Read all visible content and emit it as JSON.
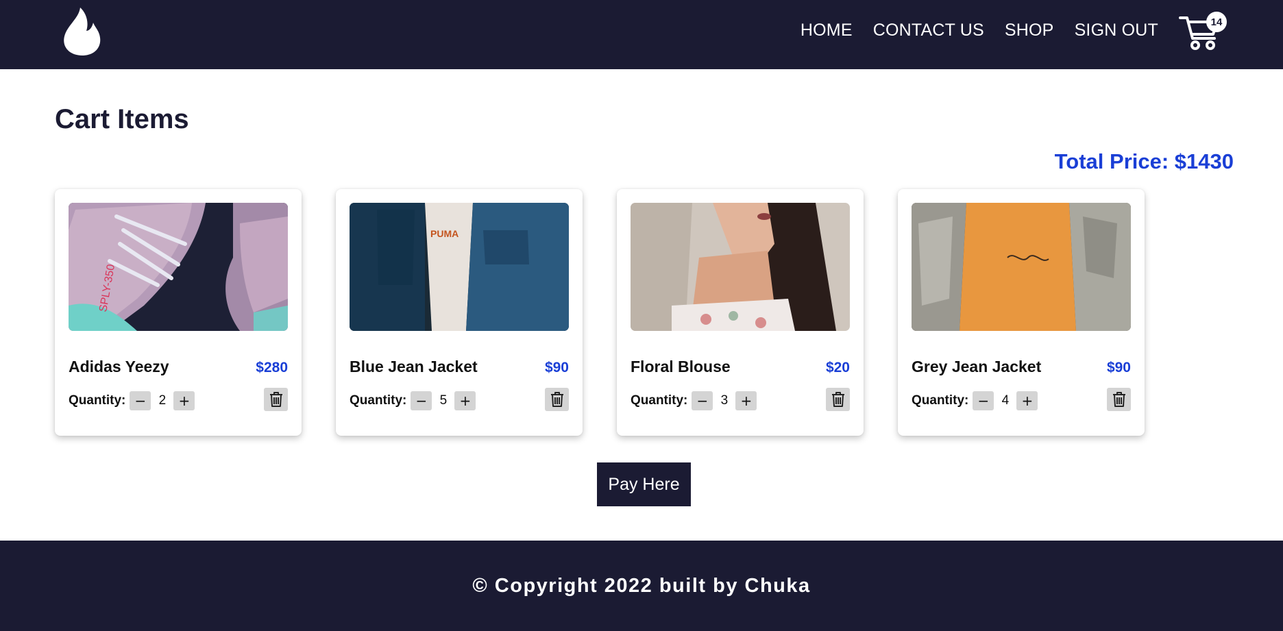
{
  "nav": {
    "links": [
      "HOME",
      "CONTACT US",
      "SHOP",
      "SIGN OUT"
    ],
    "cart_count": "14"
  },
  "main": {
    "title": "Cart Items",
    "total_label": "Total Price: $1430",
    "quantity_label": "Quantity:",
    "items": [
      {
        "name": "Adidas Yeezy",
        "price": "$280",
        "quantity": "2"
      },
      {
        "name": "Blue Jean Jacket",
        "price": "$90",
        "quantity": "5"
      },
      {
        "name": "Floral Blouse",
        "price": "$20",
        "quantity": "3"
      },
      {
        "name": "Grey Jean Jacket",
        "price": "$90",
        "quantity": "4"
      }
    ],
    "pay_label": "Pay Here"
  },
  "footer": {
    "copyright": "© Copyright 2022 built by Chuka"
  },
  "colors": {
    "navy": "#1b1b33",
    "accent_blue": "#1a3fd6",
    "button_grey": "#d4d4d4"
  },
  "icons": [
    "flame-logo-icon",
    "shopping-cart-icon",
    "minus-icon",
    "plus-icon",
    "trash-icon"
  ]
}
